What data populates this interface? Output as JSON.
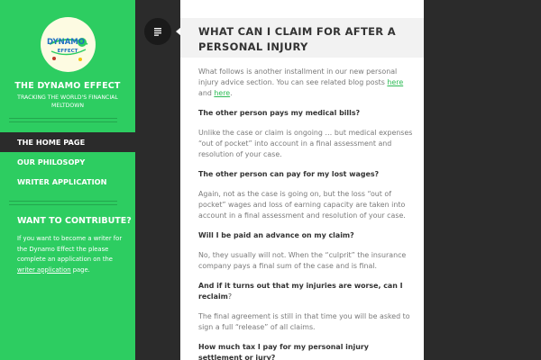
{
  "site": {
    "logo_line1": "DYNAMO",
    "logo_line2": "EFFECT",
    "title": "THE DYNAMO EFFECT",
    "tagline": "TRACKING THE WORLD'S FINANCIAL MELTDOWN"
  },
  "nav": {
    "items": [
      {
        "label": "THE HOME PAGE"
      },
      {
        "label": "OUR PHILOSOPY"
      },
      {
        "label": "WRITER APPLICATION"
      }
    ]
  },
  "contribute": {
    "heading": "WANT TO CONTRIBUTE?",
    "text_before": "If you want to become a writer for the Dynamo Effect the please complete an application on the ",
    "link": "writer application",
    "text_after": " page."
  },
  "post": {
    "title": "WHAT CAN I CLAIM FOR AFTER A PERSONAL INJURY",
    "intro_before": "What follows is another installment in our new personal injury advice section. You can see related blog posts ",
    "intro_link1": "here",
    "intro_mid": " and ",
    "intro_link2": "here",
    "intro_after": ".",
    "q1": "The other person pays my medical bills?",
    "a1": "Unlike the case or claim is ongoing … but medical expenses “out of pocket” into account in a final assessment and resolution of your case.",
    "q2": "The other person can pay for my lost wages?",
    "a2": "Again, not as the case is going on, but the loss “out of pocket” wages and loss of earning capacity are taken into account in a final assessment and resolution of your case.",
    "q3": "Will I be paid an advance on my claim?",
    "a3": "No, they usually will not. When the “culprit” the insurance company pays a final sum of the case and is final.",
    "q4": "And if it turns out that my injuries are worse, can I reclaim",
    "q4_rest": "?",
    "a4": "The final agreement is still in that time you will be asked to sign a full “release” of all claims.",
    "q5": "How much tax I pay for my personal injury settlement or jury?"
  },
  "colors": {
    "sidebar_green": "#2dcd61",
    "dark": "#2b2b2b",
    "link_green": "#2dbb55"
  },
  "icons": {
    "toggle": "sidebar-toggle-icon"
  }
}
